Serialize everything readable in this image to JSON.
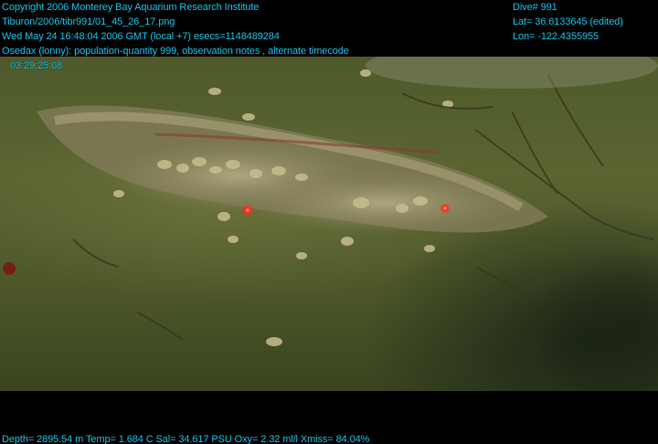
{
  "overlay": {
    "header_lines": [
      "Copyright 2006 Monterey Bay Aquarium Research Institute",
      "Tiburon/2006/tibr991/01_45_26_17.png",
      "Wed May 24 16:48:04 2006 GMT (local +7)  esecs=1148489284",
      "Osedax (lonny): population-quantity 999, observation notes , alternate timecode",
      "03:29:25:08"
    ],
    "dive_label": "Dive# 991",
    "lat": "Lat= 36.6133645 (edited)",
    "lon": "Lon= -122.4355955",
    "footer": "Depth= 2895.54 m  Temp= 1.684 C  Sal= 34.617 PSU  Oxy= 2.32 ml/l  Xmiss= 84.04%"
  },
  "scene": {
    "description_colors": {
      "sediment": "#55602e",
      "bone": "#a59c75",
      "laser_dot": "#ff2a1a",
      "overlay_text": "#15c3e8"
    }
  }
}
